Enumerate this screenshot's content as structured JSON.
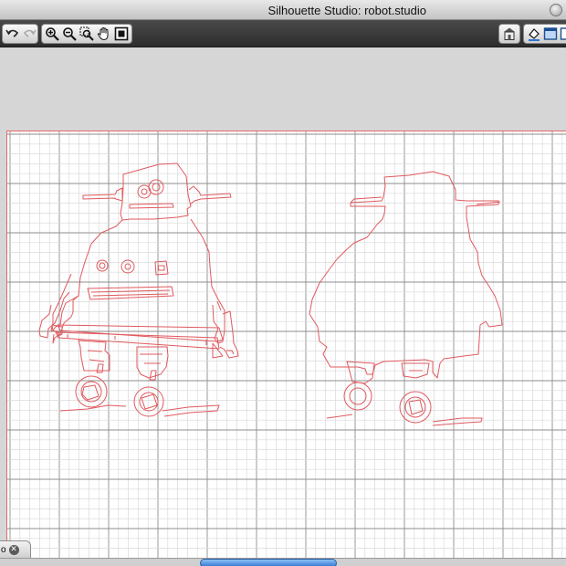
{
  "window": {
    "title": "Silhouette Studio: robot.studio"
  },
  "toolbar": {
    "left_group": [
      {
        "name": "undo-icon"
      },
      {
        "name": "redo-icon"
      }
    ],
    "zoom_group": [
      {
        "name": "zoom-in-icon"
      },
      {
        "name": "zoom-out-icon"
      },
      {
        "name": "zoom-select-icon"
      },
      {
        "name": "pan-icon"
      },
      {
        "name": "fit-page-icon"
      }
    ],
    "right_group": [
      {
        "name": "store-icon"
      },
      {
        "name": "fill-icon"
      },
      {
        "name": "window-icon"
      },
      {
        "name": "panel-icon"
      }
    ]
  },
  "document_tab": {
    "label": "o",
    "close_symbol": "✕"
  },
  "colors": {
    "toolbar": "#333333",
    "canvas": "#ffffff",
    "grid_minor": "#dadada",
    "grid_major": "#8e8e8e",
    "cut_line": "#e0595e",
    "scroll_thumb": "#2f74d0"
  }
}
